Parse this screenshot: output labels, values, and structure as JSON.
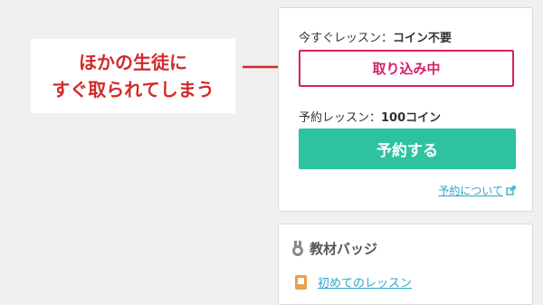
{
  "callout": {
    "line1": "ほかの生徒に",
    "line2": "すぐ取られてしまう"
  },
  "lesson_card": {
    "now_label": "今すぐレッスン：",
    "now_value": "コイン不要",
    "occupied_label": "取り込み中",
    "reserve_label": "予約レッスン：",
    "reserve_value": "100コイン",
    "reserve_button": "予約する",
    "about_link": "予約について"
  },
  "badge_card": {
    "title": "教材バッジ",
    "first_item": "初めてのレッスン"
  },
  "colors": {
    "callout_red": "#d22a2a",
    "occupied_pink": "#d61f6a",
    "reserve_green": "#2dc3a0",
    "link_blue": "#2ba7c9"
  },
  "icons": [
    "arrow-right-icon",
    "external-link-icon",
    "medal-icon",
    "badge-icon"
  ]
}
